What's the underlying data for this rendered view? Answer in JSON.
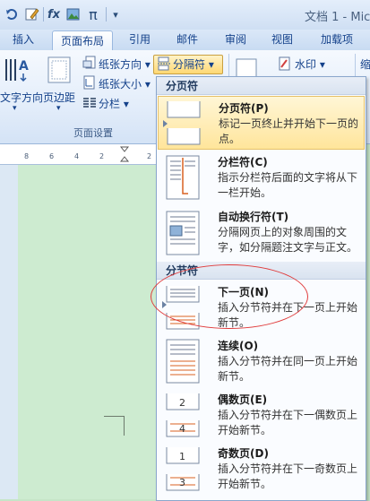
{
  "title_bar": {
    "doc_title": "文档 1 - Mic",
    "quick_icons": [
      "undo-icon",
      "edit-icon",
      "formula-fx-icon",
      "image-edit-icon",
      "pi-icon",
      "dropdown-icon"
    ],
    "pi_glyph": "π",
    "fx_glyph": "fx",
    "dropdown_glyph": "▾"
  },
  "tabs": [
    {
      "label": "插入"
    },
    {
      "label": "页面布局",
      "active": true
    },
    {
      "label": "引用"
    },
    {
      "label": "邮件"
    },
    {
      "label": "审阅"
    },
    {
      "label": "视图"
    },
    {
      "label": "加载项"
    }
  ],
  "ribbon": {
    "text_direction": "文字方向",
    "margins": "页边距",
    "orientation": "纸张方向 ▾",
    "size": "纸张大小 ▾",
    "columns": "分栏 ▾",
    "breaks": "分隔符 ▾",
    "watermark": "水印 ▾",
    "group_page_setup": "页面设置",
    "cut_label": "缩"
  },
  "ruler": {
    "ticks": [
      "8",
      "6",
      "4",
      "2",
      "2"
    ]
  },
  "menu": {
    "section_page_breaks": "分页符",
    "section_section_breaks": "分节符",
    "items": [
      {
        "title": "分页符(P)",
        "desc": "标记一页终止并开始下一页的点。",
        "highlight": true
      },
      {
        "title": "分栏符(C)",
        "desc": "指示分栏符后面的文字将从下一栏开始。"
      },
      {
        "title": "自动换行符(T)",
        "desc": "分隔网页上的对象周围的文字，如分隔题注文字与正文。"
      },
      {
        "title": "下一页(N)",
        "desc": "插入分节符并在下一页上开始新节。"
      },
      {
        "title": "连续(O)",
        "desc": "插入分节符并在同一页上开始新节。"
      },
      {
        "title": "偶数页(E)",
        "desc": "插入分节符并在下一偶数页上开始新节。"
      },
      {
        "title": "奇数页(D)",
        "desc": "插入分节符并在下一奇数页上开始新节。"
      }
    ]
  },
  "colors": {
    "accent": "#15428b",
    "highlight": "#ffe59b",
    "annotation": "#e03a3a",
    "page_bg": "#cdebd0"
  }
}
